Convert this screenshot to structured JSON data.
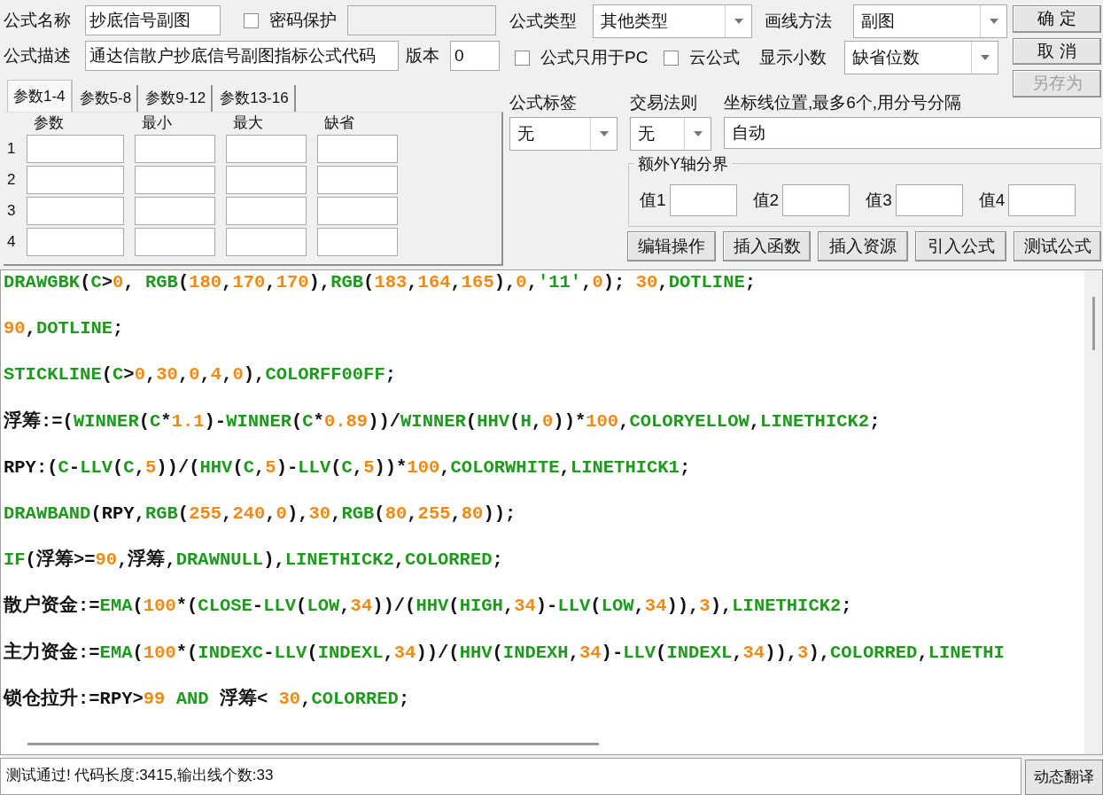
{
  "formula_name": {
    "label": "公式名称",
    "value": "抄底信号副图"
  },
  "password": {
    "label": "密码保护",
    "checked": false
  },
  "description": {
    "label": "公式描述",
    "value": "通达信散户抄底信号副图指标公式代码"
  },
  "version": {
    "label": "版本",
    "value": "0"
  },
  "param_tabs": [
    {
      "label": "参数1-4",
      "selected": true
    },
    {
      "label": "参数5-8",
      "selected": false
    },
    {
      "label": "参数9-12",
      "selected": false
    },
    {
      "label": "参数13-16",
      "selected": false
    }
  ],
  "param_table": {
    "columns": [
      "参数",
      "最小",
      "最大",
      "缺省"
    ],
    "rows": [
      "1",
      "2",
      "3",
      "4"
    ]
  },
  "formula_type": {
    "label": "公式类型",
    "value": "其他类型"
  },
  "draw_method": {
    "label": "画线方法",
    "value": "副图"
  },
  "pc_only": {
    "label": "公式只用于PC",
    "checked": false
  },
  "cloud": {
    "label": "云公式",
    "checked": false
  },
  "decimals": {
    "label": "显示小数",
    "value": "缺省位数"
  },
  "buttons": [
    {
      "label": "确 定",
      "disabled": false
    },
    {
      "label": "取 消",
      "disabled": false
    },
    {
      "label": "另存为",
      "disabled": true
    }
  ],
  "formula_tag": {
    "label": "公式标签",
    "value": "无"
  },
  "trade_rule": {
    "label": "交易法则",
    "value": "无"
  },
  "axis_lines": {
    "label": "坐标线位置,最多6个,用分号分隔",
    "value": "自动"
  },
  "y_bounds": {
    "title": "额外Y轴分界",
    "fields": [
      "值1",
      "值2",
      "值3",
      "值4"
    ]
  },
  "tool_buttons": [
    "编辑操作",
    "插入函数",
    "插入资源",
    "引入公式",
    "测试公式"
  ],
  "code_lines": [
    {
      "tokens": [
        {
          "kind": "func",
          "text": "DRAWGBK"
        },
        {
          "kind": "plain",
          "text": "("
        },
        {
          "kind": "func",
          "text": "C"
        },
        {
          "kind": "plain",
          "text": ">"
        },
        {
          "kind": "number",
          "text": "0"
        },
        {
          "kind": "plain",
          "text": ", "
        },
        {
          "kind": "func",
          "text": "RGB"
        },
        {
          "kind": "plain",
          "text": "("
        },
        {
          "kind": "number",
          "text": "180"
        },
        {
          "kind": "plain",
          "text": ","
        },
        {
          "kind": "number",
          "text": "170"
        },
        {
          "kind": "plain",
          "text": ","
        },
        {
          "kind": "number",
          "text": "170"
        },
        {
          "kind": "plain",
          "text": "),"
        },
        {
          "kind": "func",
          "text": "RGB"
        },
        {
          "kind": "plain",
          "text": "("
        },
        {
          "kind": "number",
          "text": "183"
        },
        {
          "kind": "plain",
          "text": ","
        },
        {
          "kind": "number",
          "text": "164"
        },
        {
          "kind": "plain",
          "text": ","
        },
        {
          "kind": "number",
          "text": "165"
        },
        {
          "kind": "plain",
          "text": "),"
        },
        {
          "kind": "number",
          "text": "0"
        },
        {
          "kind": "plain",
          "text": ","
        },
        {
          "kind": "func",
          "text": "'11'"
        },
        {
          "kind": "plain",
          "text": ","
        },
        {
          "kind": "number",
          "text": "0"
        },
        {
          "kind": "plain",
          "text": "); "
        },
        {
          "kind": "number",
          "text": "30"
        },
        {
          "kind": "plain",
          "text": ","
        },
        {
          "kind": "func",
          "text": "DOTLINE"
        },
        {
          "kind": "plain",
          "text": ";"
        }
      ]
    },
    {
      "tokens": [
        {
          "kind": "number",
          "text": "90"
        },
        {
          "kind": "plain",
          "text": ","
        },
        {
          "kind": "func",
          "text": "DOTLINE"
        },
        {
          "kind": "plain",
          "text": ";"
        }
      ]
    },
    {
      "tokens": [
        {
          "kind": "func",
          "text": "STICKLINE"
        },
        {
          "kind": "plain",
          "text": "("
        },
        {
          "kind": "func",
          "text": "C"
        },
        {
          "kind": "plain",
          "text": ">"
        },
        {
          "kind": "number",
          "text": "0"
        },
        {
          "kind": "plain",
          "text": ","
        },
        {
          "kind": "number",
          "text": "30"
        },
        {
          "kind": "plain",
          "text": ","
        },
        {
          "kind": "number",
          "text": "0"
        },
        {
          "kind": "plain",
          "text": ","
        },
        {
          "kind": "number",
          "text": "4"
        },
        {
          "kind": "plain",
          "text": ","
        },
        {
          "kind": "number",
          "text": "0"
        },
        {
          "kind": "plain",
          "text": "),"
        },
        {
          "kind": "func",
          "text": "COLORFF00FF"
        },
        {
          "kind": "plain",
          "text": ";"
        }
      ]
    },
    {
      "tokens": [
        {
          "kind": "plain",
          "text": "浮筹:=("
        },
        {
          "kind": "func",
          "text": "WINNER"
        },
        {
          "kind": "plain",
          "text": "("
        },
        {
          "kind": "func",
          "text": "C"
        },
        {
          "kind": "plain",
          "text": "*"
        },
        {
          "kind": "number",
          "text": "1.1"
        },
        {
          "kind": "plain",
          "text": ")-"
        },
        {
          "kind": "func",
          "text": "WINNER"
        },
        {
          "kind": "plain",
          "text": "("
        },
        {
          "kind": "func",
          "text": "C"
        },
        {
          "kind": "plain",
          "text": "*"
        },
        {
          "kind": "number",
          "text": "0.89"
        },
        {
          "kind": "plain",
          "text": "))/"
        },
        {
          "kind": "func",
          "text": "WINNER"
        },
        {
          "kind": "plain",
          "text": "("
        },
        {
          "kind": "func",
          "text": "HHV"
        },
        {
          "kind": "plain",
          "text": "("
        },
        {
          "kind": "func",
          "text": "H"
        },
        {
          "kind": "plain",
          "text": ","
        },
        {
          "kind": "number",
          "text": "0"
        },
        {
          "kind": "plain",
          "text": "))*"
        },
        {
          "kind": "number",
          "text": "100"
        },
        {
          "kind": "plain",
          "text": ","
        },
        {
          "kind": "func",
          "text": "COLORYELLOW"
        },
        {
          "kind": "plain",
          "text": ","
        },
        {
          "kind": "func",
          "text": "LINETHICK2"
        },
        {
          "kind": "plain",
          "text": ";"
        }
      ]
    },
    {
      "tokens": [
        {
          "kind": "plain",
          "text": "RPY:("
        },
        {
          "kind": "func",
          "text": "C"
        },
        {
          "kind": "plain",
          "text": "-"
        },
        {
          "kind": "func",
          "text": "LLV"
        },
        {
          "kind": "plain",
          "text": "("
        },
        {
          "kind": "func",
          "text": "C"
        },
        {
          "kind": "plain",
          "text": ","
        },
        {
          "kind": "number",
          "text": "5"
        },
        {
          "kind": "plain",
          "text": "))/("
        },
        {
          "kind": "func",
          "text": "HHV"
        },
        {
          "kind": "plain",
          "text": "("
        },
        {
          "kind": "func",
          "text": "C"
        },
        {
          "kind": "plain",
          "text": ","
        },
        {
          "kind": "number",
          "text": "5"
        },
        {
          "kind": "plain",
          "text": ")-"
        },
        {
          "kind": "func",
          "text": "LLV"
        },
        {
          "kind": "plain",
          "text": "("
        },
        {
          "kind": "func",
          "text": "C"
        },
        {
          "kind": "plain",
          "text": ","
        },
        {
          "kind": "number",
          "text": "5"
        },
        {
          "kind": "plain",
          "text": "))*"
        },
        {
          "kind": "number",
          "text": "100"
        },
        {
          "kind": "plain",
          "text": ","
        },
        {
          "kind": "func",
          "text": "COLORWHITE"
        },
        {
          "kind": "plain",
          "text": ","
        },
        {
          "kind": "func",
          "text": "LINETHICK1"
        },
        {
          "kind": "plain",
          "text": ";"
        }
      ]
    },
    {
      "tokens": [
        {
          "kind": "func",
          "text": "DRAWBAND"
        },
        {
          "kind": "plain",
          "text": "(RPY,"
        },
        {
          "kind": "func",
          "text": "RGB"
        },
        {
          "kind": "plain",
          "text": "("
        },
        {
          "kind": "number",
          "text": "255"
        },
        {
          "kind": "plain",
          "text": ","
        },
        {
          "kind": "number",
          "text": "240"
        },
        {
          "kind": "plain",
          "text": ","
        },
        {
          "kind": "number",
          "text": "0"
        },
        {
          "kind": "plain",
          "text": "),"
        },
        {
          "kind": "number",
          "text": "30"
        },
        {
          "kind": "plain",
          "text": ","
        },
        {
          "kind": "func",
          "text": "RGB"
        },
        {
          "kind": "plain",
          "text": "("
        },
        {
          "kind": "number",
          "text": "80"
        },
        {
          "kind": "plain",
          "text": ","
        },
        {
          "kind": "number",
          "text": "255"
        },
        {
          "kind": "plain",
          "text": ","
        },
        {
          "kind": "number",
          "text": "80"
        },
        {
          "kind": "plain",
          "text": "));"
        }
      ]
    },
    {
      "tokens": [
        {
          "kind": "func",
          "text": "IF"
        },
        {
          "kind": "plain",
          "text": "(浮筹>="
        },
        {
          "kind": "number",
          "text": "90"
        },
        {
          "kind": "plain",
          "text": ",浮筹,"
        },
        {
          "kind": "func",
          "text": "DRAWNULL"
        },
        {
          "kind": "plain",
          "text": "),"
        },
        {
          "kind": "func",
          "text": "LINETHICK2"
        },
        {
          "kind": "plain",
          "text": ","
        },
        {
          "kind": "func",
          "text": "COLORRED"
        },
        {
          "kind": "plain",
          "text": ";"
        }
      ]
    },
    {
      "tokens": [
        {
          "kind": "plain",
          "text": "散户资金:="
        },
        {
          "kind": "func",
          "text": "EMA"
        },
        {
          "kind": "plain",
          "text": "("
        },
        {
          "kind": "number",
          "text": "100"
        },
        {
          "kind": "plain",
          "text": "*("
        },
        {
          "kind": "func",
          "text": "CLOSE"
        },
        {
          "kind": "plain",
          "text": "-"
        },
        {
          "kind": "func",
          "text": "LLV"
        },
        {
          "kind": "plain",
          "text": "("
        },
        {
          "kind": "func",
          "text": "LOW"
        },
        {
          "kind": "plain",
          "text": ","
        },
        {
          "kind": "number",
          "text": "34"
        },
        {
          "kind": "plain",
          "text": "))/("
        },
        {
          "kind": "func",
          "text": "HHV"
        },
        {
          "kind": "plain",
          "text": "("
        },
        {
          "kind": "func",
          "text": "HIGH"
        },
        {
          "kind": "plain",
          "text": ","
        },
        {
          "kind": "number",
          "text": "34"
        },
        {
          "kind": "plain",
          "text": ")-"
        },
        {
          "kind": "func",
          "text": "LLV"
        },
        {
          "kind": "plain",
          "text": "("
        },
        {
          "kind": "func",
          "text": "LOW"
        },
        {
          "kind": "plain",
          "text": ","
        },
        {
          "kind": "number",
          "text": "34"
        },
        {
          "kind": "plain",
          "text": ")),"
        },
        {
          "kind": "number",
          "text": "3"
        },
        {
          "kind": "plain",
          "text": "),"
        },
        {
          "kind": "func",
          "text": "LINETHICK2"
        },
        {
          "kind": "plain",
          "text": ";"
        }
      ]
    },
    {
      "tokens": [
        {
          "kind": "plain",
          "text": "主力资金:="
        },
        {
          "kind": "func",
          "text": "EMA"
        },
        {
          "kind": "plain",
          "text": "("
        },
        {
          "kind": "number",
          "text": "100"
        },
        {
          "kind": "plain",
          "text": "*("
        },
        {
          "kind": "func",
          "text": "INDEXC"
        },
        {
          "kind": "plain",
          "text": "-"
        },
        {
          "kind": "func",
          "text": "LLV"
        },
        {
          "kind": "plain",
          "text": "("
        },
        {
          "kind": "func",
          "text": "INDEXL"
        },
        {
          "kind": "plain",
          "text": ","
        },
        {
          "kind": "number",
          "text": "34"
        },
        {
          "kind": "plain",
          "text": "))/("
        },
        {
          "kind": "func",
          "text": "HHV"
        },
        {
          "kind": "plain",
          "text": "("
        },
        {
          "kind": "func",
          "text": "INDEXH"
        },
        {
          "kind": "plain",
          "text": ","
        },
        {
          "kind": "number",
          "text": "34"
        },
        {
          "kind": "plain",
          "text": ")-"
        },
        {
          "kind": "func",
          "text": "LLV"
        },
        {
          "kind": "plain",
          "text": "("
        },
        {
          "kind": "func",
          "text": "INDEXL"
        },
        {
          "kind": "plain",
          "text": ","
        },
        {
          "kind": "number",
          "text": "34"
        },
        {
          "kind": "plain",
          "text": ")),"
        },
        {
          "kind": "number",
          "text": "3"
        },
        {
          "kind": "plain",
          "text": "),"
        },
        {
          "kind": "func",
          "text": "COLORRED"
        },
        {
          "kind": "plain",
          "text": ","
        },
        {
          "kind": "func",
          "text": "LINETHI"
        }
      ]
    },
    {
      "tokens": [
        {
          "kind": "plain",
          "text": "锁仓拉升:=RPY>"
        },
        {
          "kind": "number",
          "text": "99"
        },
        {
          "kind": "func",
          "text": " AND"
        },
        {
          "kind": "plain",
          "text": " 浮筹< "
        },
        {
          "kind": "number",
          "text": "30"
        },
        {
          "kind": "plain",
          "text": ","
        },
        {
          "kind": "func",
          "text": "COLORRED"
        },
        {
          "kind": "plain",
          "text": ";"
        }
      ]
    }
  ],
  "status": "测试通过! 代码长度:3415,输出线个数:33",
  "translate_button": "动态翻译"
}
